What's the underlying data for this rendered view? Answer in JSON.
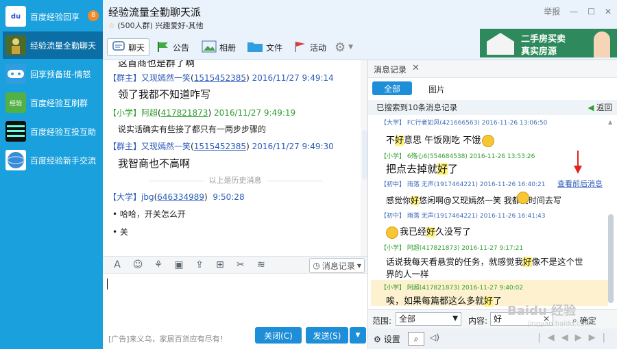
{
  "sidebar": {
    "items": [
      {
        "label": "百度经验回享",
        "badge": "8",
        "icon": "baidu-du-icon",
        "color": "#ffffff"
      },
      {
        "label": "经验流量全勤聊天",
        "badge": "",
        "icon": "group-avatar-icon",
        "color": "#4c6b2a"
      },
      {
        "label": "回享预备班-情怒",
        "badge": "",
        "icon": "gamepad-icon",
        "color": "#2f9de0"
      },
      {
        "label": "百度经验互刷群",
        "badge": "",
        "icon": "jingyan-icon",
        "color": "#53b045"
      },
      {
        "label": "百度经验互投互助",
        "badge": "",
        "icon": "group-avatar-icon",
        "color": "#111111"
      },
      {
        "label": "百度经验新手交流",
        "badge": "",
        "icon": "globe-icon",
        "color": "#3a8bd6"
      }
    ]
  },
  "header": {
    "title": "经验流量全勤聊天派",
    "members": "(500人群)",
    "tags": "兴趣爱好-其他",
    "report": "举报",
    "toolbar": [
      "聊天",
      "公告",
      "相册",
      "文件",
      "活动"
    ]
  },
  "ad_banner": {
    "line1": "二手房买卖",
    "line2": "真实房源"
  },
  "chat": {
    "partial_top": "这首商也是群了啊",
    "messages": [
      {
        "group": "【群主】",
        "name": "又现嫣然一笑",
        "id": "1515452385",
        "time": "2016/11/27 9:49:14",
        "text": "领了我都不知道咋写",
        "big": true
      },
      {
        "group": "【小学】",
        "name": "阿超",
        "id": "417821873",
        "time": "2016/11/27 9:49:19",
        "text": "说实话确实有些接了都只有一两步步骤的",
        "big": false
      },
      {
        "group": "【群主】",
        "name": "又现嫣然一笑",
        "id": "1515452385",
        "time": "2016/11/27 9:49:30",
        "text": "我智商也不高啊",
        "big": true
      }
    ],
    "history_separator": "以上是历史消息",
    "recent": {
      "group": "【大学】",
      "name": "jbg",
      "id": "646334989",
      "time": "9:50:28",
      "lines": [
        "哈哈，开关怎么开",
        "关"
      ]
    }
  },
  "input_toolbar": {
    "history_button": "消息记录"
  },
  "bottom": {
    "ad_text": "[广告]来义乌，家居百货应有尽有！",
    "close": "关闭(C)",
    "send": "发送(S)"
  },
  "panel": {
    "tab": "消息记录",
    "filters": [
      "全部",
      "图片"
    ],
    "search_info": "已搜索到10条消息记录",
    "back": "返回",
    "see_around": "查看前后消息",
    "records": [
      {
        "head": "【大学】 FC行者如风(421666563)  2016-11-26 13:06:50",
        "pre": "不",
        "hl": "好",
        "post": "意思   午饭刚吃   不饿",
        "emoji": true
      },
      {
        "head": "【小学】 6殇心6(554684538)  2016-11-26 13:53:26",
        "pre": "把点去掉就",
        "hl": "好",
        "post": "了",
        "emoji": false
      },
      {
        "head": "【初中】 雨落 无声(1917464221)  2016-11-26 16:40:21",
        "pre": "感觉你",
        "hl": "好",
        "post": "悠闲啊@又现嫣然一笑  我都没时间去写",
        "emoji": true
      },
      {
        "head": "【初中】 雨落 无声(1917464221)  2016-11-26 16:41:43",
        "pre": "我已经",
        "hl": "好",
        "post": "久没写了",
        "emoji": true
      },
      {
        "head": "【小学】 阿超(417821873)  2016-11-27 9:17:21",
        "pre": "话说我每天看悬赏的任务，就感觉我",
        "hl": "好",
        "post": "像不是这个世",
        "post2": "界的人一样",
        "emoji": false
      },
      {
        "head": "【小学】 阿超(417821873)  2016-11-27 9:40:02",
        "pre": "唉，如果每篇都这么多就",
        "hl": "好",
        "post": "了",
        "emoji": false
      }
    ],
    "range_label": "范围:",
    "range_value": "全部",
    "content_label": "内容:",
    "content_value": "好",
    "confirm": "确定",
    "settings": "设置"
  },
  "watermark": {
    "text": "Baidu 经验",
    "url": "jingyan.baidu.com"
  }
}
